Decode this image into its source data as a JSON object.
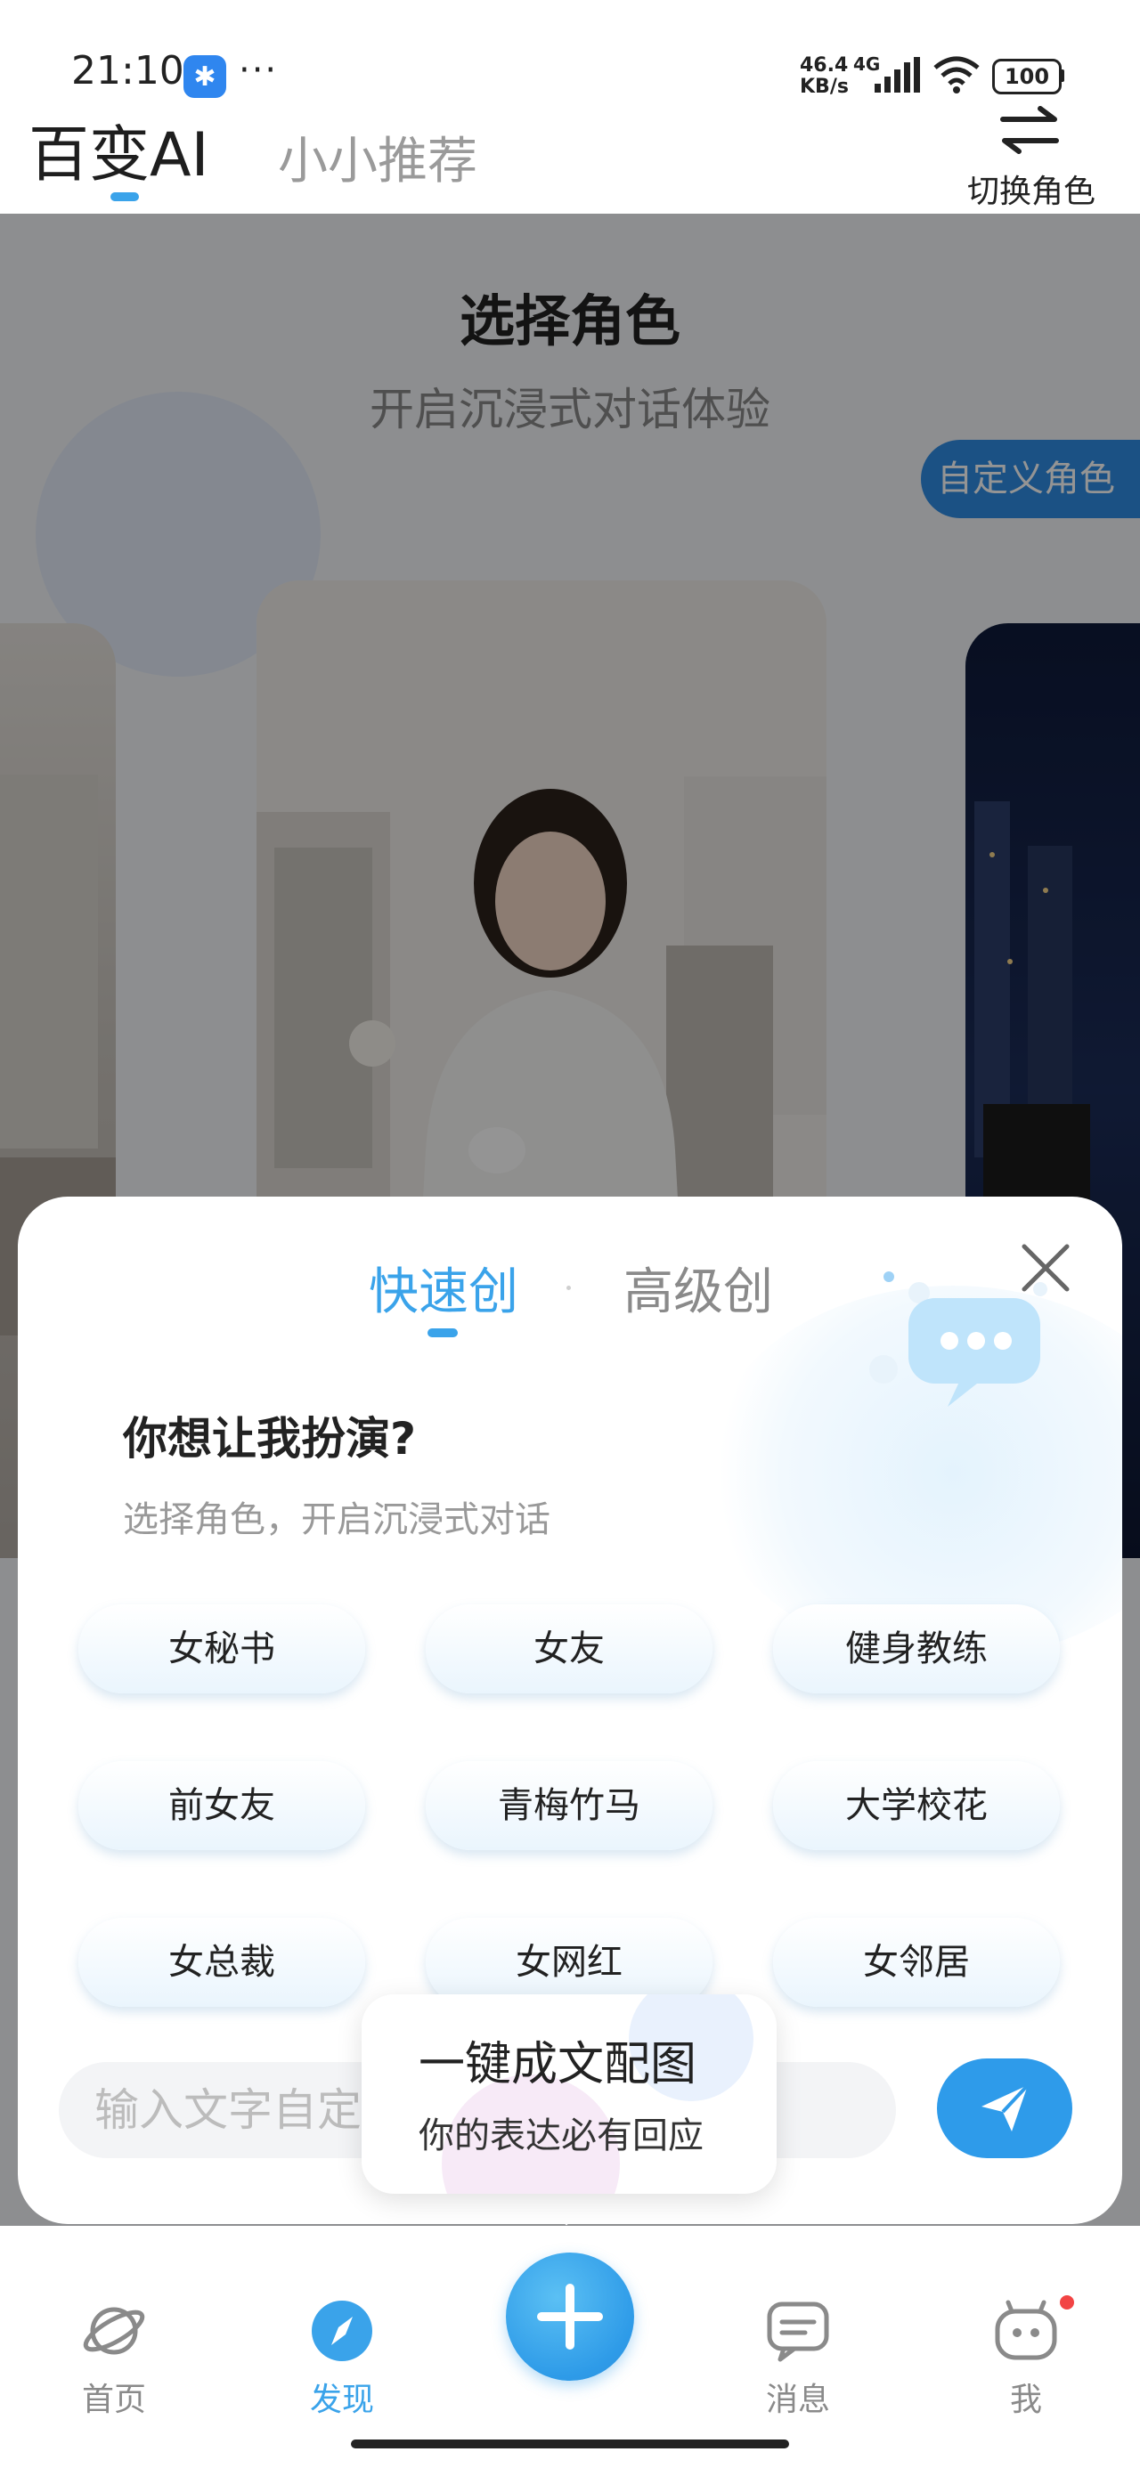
{
  "status_bar": {
    "time": "21:10",
    "dots": "···",
    "net_speed_value": "46.4",
    "net_speed_unit": "KB/s",
    "net_type": "4G",
    "battery": "100"
  },
  "header": {
    "tabs": [
      {
        "label": "百变AI",
        "active": true
      },
      {
        "label": "小小推荐",
        "active": false
      }
    ],
    "switch_role_label": "切换角色"
  },
  "background": {
    "title": "选择角色",
    "subtitle": "开启沉浸式对话体验",
    "custom_role_button": "自定义角色"
  },
  "modal": {
    "tabs": [
      {
        "label": "快速创",
        "active": true
      },
      {
        "label": "高级创",
        "active": false
      }
    ],
    "heading": "你想让我扮演?",
    "subheading": "选择角色，开启沉浸式对话",
    "roles": [
      "女秘书",
      "女友",
      "健身教练",
      "前女友",
      "青梅竹马",
      "大学校花",
      "女总裁",
      "女网红",
      "女邻居"
    ],
    "input_placeholder": "输入文字自定义"
  },
  "tooltip": {
    "title": "一键成文配图",
    "subtitle": "你的表达必有回应"
  },
  "bottom_nav": {
    "items": [
      {
        "label": "首页",
        "icon": "planet-icon",
        "active": false
      },
      {
        "label": "发现",
        "icon": "compass-icon",
        "active": true
      },
      {
        "label": "消息",
        "icon": "message-icon",
        "active": false
      },
      {
        "label": "我",
        "icon": "robot-face-icon",
        "active": false
      }
    ]
  },
  "colors": {
    "accent": "#3aa3ea",
    "nav_active": "#3aa3ea",
    "nav_inactive": "#8a8a8a",
    "badge": "#f24444"
  }
}
